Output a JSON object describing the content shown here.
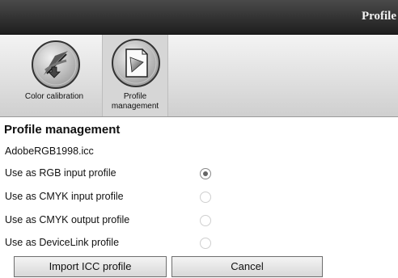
{
  "window": {
    "title": "Profile"
  },
  "toolbar": {
    "items": [
      {
        "label": "Color calibration",
        "icon": "color-calibration-icon"
      },
      {
        "label_line1": "Profile",
        "label_line2": "management",
        "icon": "profile-management-icon"
      }
    ]
  },
  "main": {
    "heading": "Profile management",
    "filename": "AdobeRGB1998.icc",
    "options": [
      {
        "label": "Use as RGB input profile",
        "checked": true
      },
      {
        "label": "Use as CMYK input profile",
        "checked": false
      },
      {
        "label": "Use as CMYK output profile",
        "checked": false
      },
      {
        "label": "Use as DeviceLink profile",
        "checked": false
      }
    ],
    "buttons": {
      "import_label": "Import ICC profile",
      "cancel_label": "Cancel"
    }
  }
}
